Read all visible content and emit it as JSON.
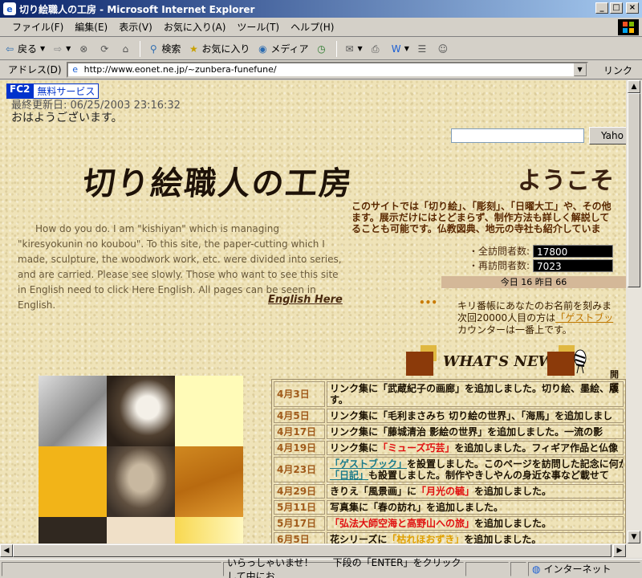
{
  "window": {
    "title": "切り絵職人の工房 - Microsoft Internet Explorer",
    "minimize": "_",
    "maximize": "□",
    "close": "×"
  },
  "menu": [
    "ファイル(F)",
    "編集(E)",
    "表示(V)",
    "お気に入り(A)",
    "ツール(T)",
    "ヘルプ(H)"
  ],
  "toolbar": {
    "back": "戻る",
    "search": "検索",
    "favorites": "お気に入り",
    "media": "メディア"
  },
  "address": {
    "label": "アドレス(D)",
    "url": "http://www.eonet.ne.jp/~zunbera-funefune/",
    "links": "リンク"
  },
  "page": {
    "fc2": "FC2",
    "free_service": "無料サービス",
    "last_update": "最終更新日: 06/25/2003 23:16:32",
    "greeting": "おはようございます。",
    "search_button": "Yaho",
    "logo_text": "切り絵職人の工房",
    "welcome": "ようこそ",
    "intro_jp": [
      "このサイトでは「切り絵」、「彫刻」、「日曜大工」や、その他",
      "ます。展示だけにはとどまらず、制作方法も詳しく解説して",
      "ることも可能です。仏教図典、地元の寺社も紹介していま"
    ],
    "english_intro": "How do you do. I am \"kishiyan\" which is managing \"kiresyokunin no koubou\". To this site, the paper-cutting which I made, sculpture, the woodwork work, etc. were divided into series, and are carried. Please see slowly. Those who want to see this site in English need to click Here English. All pages can be seen in English.",
    "english_here": "English Here",
    "counter_total_label": "・全訪問者数:",
    "counter_total": "17800",
    "counter_return_label": "・再訪問者数:",
    "counter_return": "7023",
    "today_yesterday": "今日 16 昨日 66",
    "dots": "•••",
    "kiriban_line1": "キリ番帳にあなたのお名前を刻みま",
    "kiriban_line2_prefix": "次回20000人目の方は",
    "kiriban_line2_link": "「ゲストブッ",
    "kiriban_line3": "カウンターは一番上です。",
    "whats_new": "WHAT'S NEW",
    "open_label": "開運"
  },
  "news": [
    {
      "date": "4月3日",
      "parts": [
        {
          "t": "リンク集に「武蔵紀子の画廊」を追加しました。切り絵、墨絵、版"
        }
      ],
      "extra": "す。"
    },
    {
      "date": "4月5日",
      "parts": [
        {
          "t": "リンク集に「毛利まさみち 切り絵の世界」、「海馬」を追加しまし"
        }
      ]
    },
    {
      "date": "4月17日",
      "parts": [
        {
          "t": "リンク集に「藤城清治 影絵の世界」を追加しました。一流の影"
        }
      ]
    },
    {
      "date": "4月19日",
      "parts": [
        {
          "t": "リンク集に"
        },
        {
          "t": "「ミューズ巧芸」",
          "c": "red"
        },
        {
          "t": "を追加しました。フィギア作品と仏像"
        }
      ]
    },
    {
      "date": "4月23日",
      "parts": [
        {
          "t": "「ゲストブック」",
          "c": "link"
        },
        {
          "t": "を設置しました。このページを訪問した記念に何か"
        }
      ],
      "extra_parts": [
        {
          "t": "「日記」",
          "c": "link"
        },
        {
          "t": "も設置しました。制作やきしやんの身近な事など載せて"
        }
      ]
    },
    {
      "date": "4月29日",
      "parts": [
        {
          "t": "きりえ「風景画」に"
        },
        {
          "t": "「月光の毓」",
          "c": "red"
        },
        {
          "t": "を追加しました。"
        }
      ]
    },
    {
      "date": "5月11日",
      "parts": [
        {
          "t": "写真集に「春の訪れ」を追加しました。"
        }
      ]
    },
    {
      "date": "5月17日",
      "parts": [
        {
          "t": "「弘法大師空海と高野山への旅」",
          "c": "red"
        },
        {
          "t": "を追加しました。"
        }
      ]
    },
    {
      "date": "6月5日",
      "parts": [
        {
          "t": "花シリーズに"
        },
        {
          "t": "「枯れほおずき」",
          "c": "yellow"
        },
        {
          "t": "を追加しました。"
        }
      ]
    }
  ],
  "status": {
    "cell1": "",
    "message": "いらっしゃいませ！　　下段の「ENTER」をクリックして中にお",
    "zone": "インターネット"
  },
  "colors": {
    "page_bg": "#efe3b8",
    "accent_brown": "#8b3a0a",
    "link_teal": "#1a7a8a",
    "highlight_red": "#e01010"
  }
}
